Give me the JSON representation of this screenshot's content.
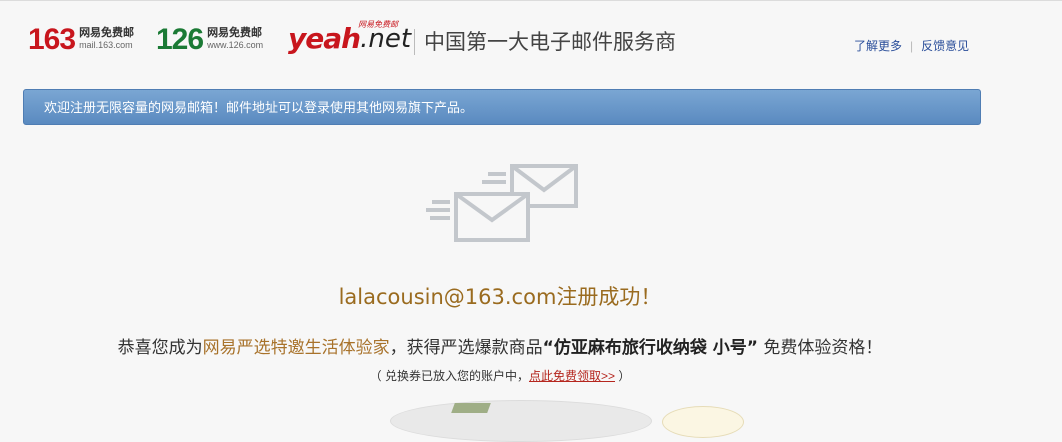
{
  "brands": {
    "b163": {
      "num": "163",
      "cn": "网易免费邮",
      "domain": "mail.163.com"
    },
    "b126": {
      "num": "126",
      "cn": "网易免费邮",
      "domain": "www.126.com"
    },
    "yeah": {
      "word": "yeah",
      "suffix": ".net",
      "tag": "网易免费邮"
    }
  },
  "header": {
    "slogan": "中国第一大电子邮件服务商",
    "links": {
      "learn_more": "了解更多",
      "feedback": "反馈意见"
    }
  },
  "banner": {
    "text": "欢迎注册无限容量的网易邮箱！邮件地址可以登录使用其他网易旗下产品。"
  },
  "main": {
    "success": "lalacousin@163.com注册成功！",
    "congrats_prefix": "恭喜您成为",
    "congrats_highlight": "网易严选特邀生活体验家",
    "congrats_mid": "，获得严选爆款商品",
    "congrats_product": "“仿亚麻布旅行收纳袋 小号”",
    "congrats_suffix": " 免费体验资格！",
    "note_prefix": "（ 兑换券已放入您的账户中，",
    "note_link": "点此免费领取>>",
    "note_suffix": " ）"
  },
  "colors": {
    "brand_red": "#c8161d",
    "brand_green": "#1b7a35",
    "banner_blue": "#6996c9",
    "success_gold": "#9a6b1f"
  }
}
